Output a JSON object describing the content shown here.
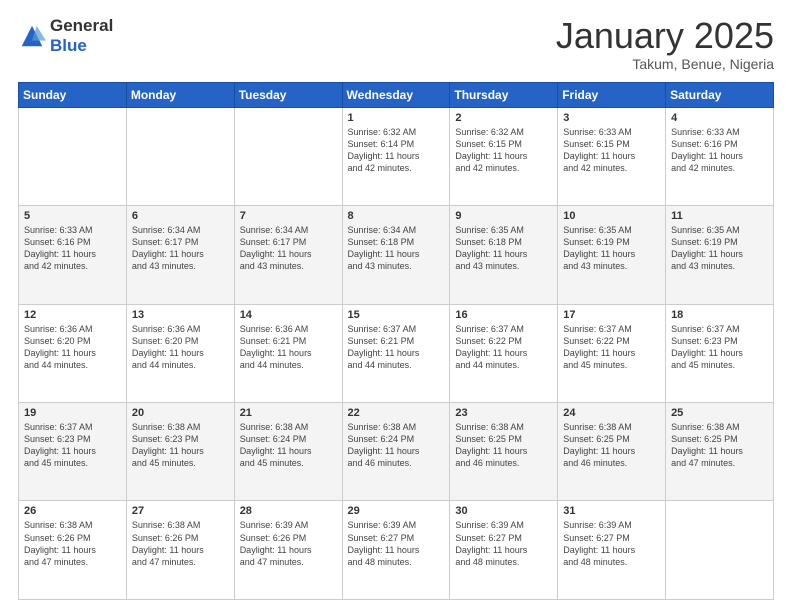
{
  "logo": {
    "general": "General",
    "blue": "Blue"
  },
  "header": {
    "month": "January 2025",
    "location": "Takum, Benue, Nigeria"
  },
  "days_of_week": [
    "Sunday",
    "Monday",
    "Tuesday",
    "Wednesday",
    "Thursday",
    "Friday",
    "Saturday"
  ],
  "weeks": [
    [
      {
        "day": "",
        "info": ""
      },
      {
        "day": "",
        "info": ""
      },
      {
        "day": "",
        "info": ""
      },
      {
        "day": "1",
        "info": "Sunrise: 6:32 AM\nSunset: 6:14 PM\nDaylight: 11 hours\nand 42 minutes."
      },
      {
        "day": "2",
        "info": "Sunrise: 6:32 AM\nSunset: 6:15 PM\nDaylight: 11 hours\nand 42 minutes."
      },
      {
        "day": "3",
        "info": "Sunrise: 6:33 AM\nSunset: 6:15 PM\nDaylight: 11 hours\nand 42 minutes."
      },
      {
        "day": "4",
        "info": "Sunrise: 6:33 AM\nSunset: 6:16 PM\nDaylight: 11 hours\nand 42 minutes."
      }
    ],
    [
      {
        "day": "5",
        "info": "Sunrise: 6:33 AM\nSunset: 6:16 PM\nDaylight: 11 hours\nand 42 minutes."
      },
      {
        "day": "6",
        "info": "Sunrise: 6:34 AM\nSunset: 6:17 PM\nDaylight: 11 hours\nand 43 minutes."
      },
      {
        "day": "7",
        "info": "Sunrise: 6:34 AM\nSunset: 6:17 PM\nDaylight: 11 hours\nand 43 minutes."
      },
      {
        "day": "8",
        "info": "Sunrise: 6:34 AM\nSunset: 6:18 PM\nDaylight: 11 hours\nand 43 minutes."
      },
      {
        "day": "9",
        "info": "Sunrise: 6:35 AM\nSunset: 6:18 PM\nDaylight: 11 hours\nand 43 minutes."
      },
      {
        "day": "10",
        "info": "Sunrise: 6:35 AM\nSunset: 6:19 PM\nDaylight: 11 hours\nand 43 minutes."
      },
      {
        "day": "11",
        "info": "Sunrise: 6:35 AM\nSunset: 6:19 PM\nDaylight: 11 hours\nand 43 minutes."
      }
    ],
    [
      {
        "day": "12",
        "info": "Sunrise: 6:36 AM\nSunset: 6:20 PM\nDaylight: 11 hours\nand 44 minutes."
      },
      {
        "day": "13",
        "info": "Sunrise: 6:36 AM\nSunset: 6:20 PM\nDaylight: 11 hours\nand 44 minutes."
      },
      {
        "day": "14",
        "info": "Sunrise: 6:36 AM\nSunset: 6:21 PM\nDaylight: 11 hours\nand 44 minutes."
      },
      {
        "day": "15",
        "info": "Sunrise: 6:37 AM\nSunset: 6:21 PM\nDaylight: 11 hours\nand 44 minutes."
      },
      {
        "day": "16",
        "info": "Sunrise: 6:37 AM\nSunset: 6:22 PM\nDaylight: 11 hours\nand 44 minutes."
      },
      {
        "day": "17",
        "info": "Sunrise: 6:37 AM\nSunset: 6:22 PM\nDaylight: 11 hours\nand 45 minutes."
      },
      {
        "day": "18",
        "info": "Sunrise: 6:37 AM\nSunset: 6:23 PM\nDaylight: 11 hours\nand 45 minutes."
      }
    ],
    [
      {
        "day": "19",
        "info": "Sunrise: 6:37 AM\nSunset: 6:23 PM\nDaylight: 11 hours\nand 45 minutes."
      },
      {
        "day": "20",
        "info": "Sunrise: 6:38 AM\nSunset: 6:23 PM\nDaylight: 11 hours\nand 45 minutes."
      },
      {
        "day": "21",
        "info": "Sunrise: 6:38 AM\nSunset: 6:24 PM\nDaylight: 11 hours\nand 45 minutes."
      },
      {
        "day": "22",
        "info": "Sunrise: 6:38 AM\nSunset: 6:24 PM\nDaylight: 11 hours\nand 46 minutes."
      },
      {
        "day": "23",
        "info": "Sunrise: 6:38 AM\nSunset: 6:25 PM\nDaylight: 11 hours\nand 46 minutes."
      },
      {
        "day": "24",
        "info": "Sunrise: 6:38 AM\nSunset: 6:25 PM\nDaylight: 11 hours\nand 46 minutes."
      },
      {
        "day": "25",
        "info": "Sunrise: 6:38 AM\nSunset: 6:25 PM\nDaylight: 11 hours\nand 47 minutes."
      }
    ],
    [
      {
        "day": "26",
        "info": "Sunrise: 6:38 AM\nSunset: 6:26 PM\nDaylight: 11 hours\nand 47 minutes."
      },
      {
        "day": "27",
        "info": "Sunrise: 6:38 AM\nSunset: 6:26 PM\nDaylight: 11 hours\nand 47 minutes."
      },
      {
        "day": "28",
        "info": "Sunrise: 6:39 AM\nSunset: 6:26 PM\nDaylight: 11 hours\nand 47 minutes."
      },
      {
        "day": "29",
        "info": "Sunrise: 6:39 AM\nSunset: 6:27 PM\nDaylight: 11 hours\nand 48 minutes."
      },
      {
        "day": "30",
        "info": "Sunrise: 6:39 AM\nSunset: 6:27 PM\nDaylight: 11 hours\nand 48 minutes."
      },
      {
        "day": "31",
        "info": "Sunrise: 6:39 AM\nSunset: 6:27 PM\nDaylight: 11 hours\nand 48 minutes."
      },
      {
        "day": "",
        "info": ""
      }
    ]
  ]
}
